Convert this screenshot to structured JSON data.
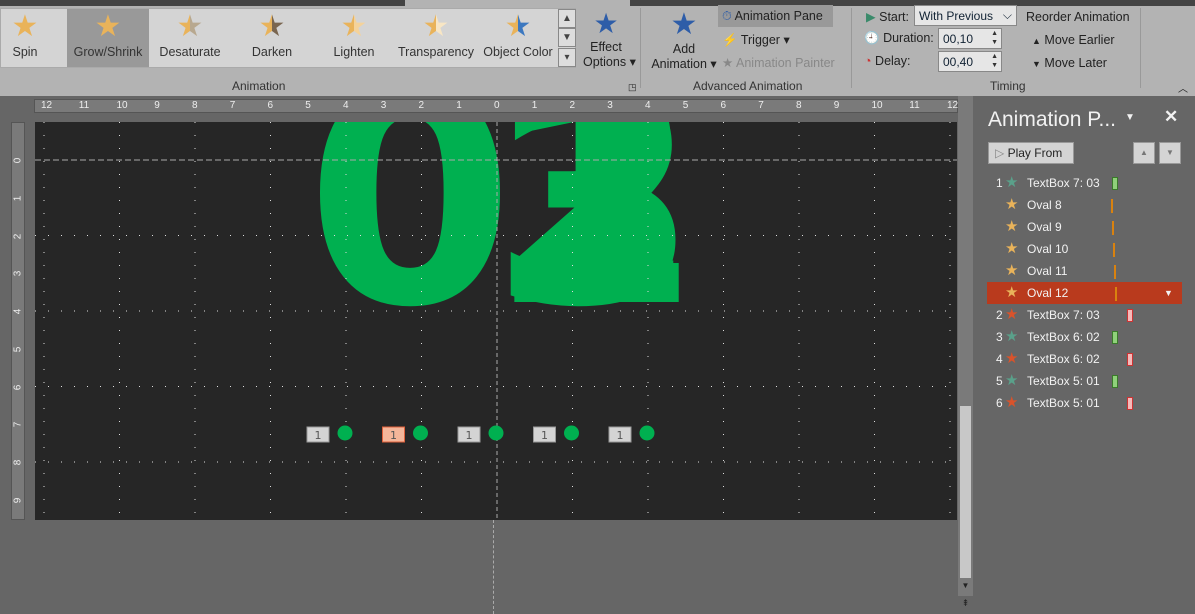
{
  "ribbon": {
    "gallery": [
      {
        "label": "Spin",
        "icon": "spin-star-icon",
        "color": "#e9b35a"
      },
      {
        "label": "Grow/Shrink",
        "icon": "grow-shrink-star-icon",
        "color": "#e9b35a",
        "selected": true
      },
      {
        "label": "Desaturate",
        "icon": "desaturate-star-icon",
        "color": "#b8a88f"
      },
      {
        "label": "Darken",
        "icon": "darken-star-icon",
        "color": "#7a6650"
      },
      {
        "label": "Lighten",
        "icon": "lighten-star-icon",
        "color": "#f4d29a"
      },
      {
        "label": "Transparency",
        "icon": "transparency-star-icon",
        "color": "#f8e6c4"
      },
      {
        "label": "Object Color",
        "icon": "object-color-star-icon",
        "color": "#3c78c0"
      }
    ],
    "effect_options": {
      "line1": "Effect",
      "line2": "Options"
    },
    "group_animation": "Animation",
    "add_animation": {
      "line1": "Add",
      "line2": "Animation"
    },
    "animation_pane": "Animation Pane",
    "trigger": "Trigger",
    "animation_painter": "Animation Painter",
    "group_advanced": "Advanced Animation",
    "start_label": "Start:",
    "start_value": "With Previous",
    "duration_label": "Duration:",
    "duration_value": "00,10",
    "delay_label": "Delay:",
    "delay_value": "00,40",
    "reorder_title": "Reorder Animation",
    "move_earlier": "Move Earlier",
    "move_later": "Move Later",
    "group_timing": "Timing"
  },
  "ruler": {
    "h": [
      "12",
      "11",
      "10",
      "9",
      "8",
      "7",
      "6",
      "5",
      "4",
      "3",
      "2",
      "1",
      "0",
      "1",
      "2",
      "3",
      "4",
      "5",
      "6",
      "7",
      "8",
      "9",
      "10",
      "11",
      "12"
    ],
    "v": [
      "0",
      "1",
      "2",
      "3",
      "4",
      "5",
      "6",
      "7",
      "8",
      "9"
    ]
  },
  "slide": {
    "big_zero": "0",
    "digits": [
      "3",
      "2",
      "1"
    ],
    "green": "#00b050",
    "markers": [
      "1",
      "1",
      "1",
      "1",
      "1"
    ],
    "marker_active": 1
  },
  "pane": {
    "title": "Animation P...",
    "play_from": "Play From",
    "items": [
      {
        "num": "1",
        "name": "TextBox 7: 03",
        "star": "#5aa08a",
        "bar": "#8fd17a",
        "bar_type": "block",
        "offset": 0
      },
      {
        "num": "",
        "name": "Oval 8",
        "star": "#e9b35a",
        "bar": "#d9820f",
        "bar_type": "line",
        "offset": 0
      },
      {
        "num": "",
        "name": "Oval 9",
        "star": "#e9b35a",
        "bar": "#d9820f",
        "bar_type": "line",
        "offset": 2
      },
      {
        "num": "",
        "name": "Oval 10",
        "star": "#e9b35a",
        "bar": "#d9820f",
        "bar_type": "line",
        "offset": 4
      },
      {
        "num": "",
        "name": "Oval 11",
        "star": "#e9b35a",
        "bar": "#d9820f",
        "bar_type": "line",
        "offset": 6
      },
      {
        "num": "",
        "name": "Oval 12",
        "star": "#e9b35a",
        "bar": "#d9820f",
        "bar_type": "line",
        "offset": 8,
        "selected": true
      },
      {
        "num": "2",
        "name": "TextBox 7: 03",
        "star": "#d9532b",
        "bar": "#f6b9b9",
        "bar_type": "block",
        "offset": 16
      },
      {
        "num": "3",
        "name": "TextBox 6: 02",
        "star": "#5aa08a",
        "bar": "#8fd17a",
        "bar_type": "block",
        "offset": 0
      },
      {
        "num": "4",
        "name": "TextBox 6: 02",
        "star": "#d9532b",
        "bar": "#f6b9b9",
        "bar_type": "block",
        "offset": 16
      },
      {
        "num": "5",
        "name": "TextBox 5: 01",
        "star": "#5aa08a",
        "bar": "#8fd17a",
        "bar_type": "block",
        "offset": 0
      },
      {
        "num": "6",
        "name": "TextBox 5: 01",
        "star": "#d9532b",
        "bar": "#f6b9b9",
        "bar_type": "block",
        "offset": 16
      }
    ]
  }
}
